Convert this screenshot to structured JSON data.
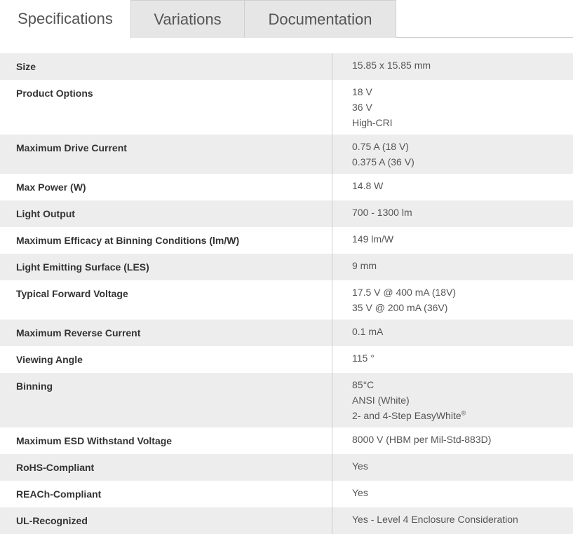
{
  "tabs": [
    {
      "label": "Specifications",
      "active": true
    },
    {
      "label": "Variations",
      "active": false
    },
    {
      "label": "Documentation",
      "active": false
    }
  ],
  "specs": [
    {
      "label": "Size",
      "values": [
        "15.85 x 15.85 mm"
      ]
    },
    {
      "label": "Product Options",
      "values": [
        "18 V",
        "36 V",
        "High-CRI"
      ]
    },
    {
      "label": "Maximum Drive Current",
      "values": [
        "0.75 A (18 V)",
        "0.375 A (36 V)"
      ]
    },
    {
      "label": "Max Power (W)",
      "values": [
        "14.8 W"
      ]
    },
    {
      "label": "Light Output",
      "values": [
        "700 - 1300 lm"
      ]
    },
    {
      "label": "Maximum Efficacy at Binning Conditions (lm/W)",
      "values": [
        "149 lm/W"
      ]
    },
    {
      "label": "Light Emitting Surface (LES)",
      "values": [
        "9 mm"
      ]
    },
    {
      "label": "Typical Forward Voltage",
      "values": [
        "17.5 V @ 400 mA (18V)",
        "35 V @ 200 mA (36V)"
      ]
    },
    {
      "label": "Maximum Reverse Current",
      "values": [
        "0.1 mA"
      ]
    },
    {
      "label": "Viewing Angle",
      "values": [
        "115 °"
      ]
    },
    {
      "label": "Binning",
      "values": [
        "85°C",
        "ANSI (White)",
        "2- and 4-Step EasyWhite"
      ],
      "superscript": "®"
    },
    {
      "label": "Maximum ESD Withstand Voltage",
      "values": [
        "8000 V (HBM per Mil-Std-883D)"
      ]
    },
    {
      "label": "RoHS-Compliant",
      "values": [
        "Yes"
      ]
    },
    {
      "label": "REACh-Compliant",
      "values": [
        "Yes"
      ]
    },
    {
      "label": "UL-Recognized",
      "values": [
        "Yes - Level 4 Enclosure Consideration"
      ]
    }
  ],
  "colors": {
    "row_alt": "#ededed",
    "tab_inactive": "#e6e6e6",
    "border": "#cfcfcf"
  }
}
